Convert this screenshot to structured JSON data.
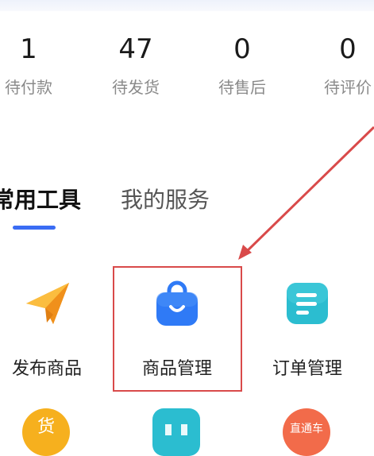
{
  "order_stats": [
    {
      "count": "1",
      "label": "待付款"
    },
    {
      "count": "47",
      "label": "待发货"
    },
    {
      "count": "0",
      "label": "待售后"
    },
    {
      "count": "0",
      "label": "待评价"
    }
  ],
  "tabs": [
    {
      "label": "常用工具",
      "active": true
    },
    {
      "label": "我的服务",
      "active": false
    }
  ],
  "tools": [
    {
      "label": "发布商品",
      "icon": "paper-plane-icon"
    },
    {
      "label": "商品管理",
      "icon": "shopping-bag-icon"
    },
    {
      "label": "订单管理",
      "icon": "document-list-icon"
    }
  ],
  "partial_row": [
    {
      "icon": "goods-badge-icon",
      "text": "货"
    },
    {
      "icon": "grid-box-icon",
      "text": ""
    },
    {
      "icon": "express-car-icon",
      "text": "直通车"
    }
  ],
  "colors": {
    "accent": "#3a6cf4",
    "annotation_red": "#d94a4a",
    "plane_orange": "#f8a623",
    "bag_blue": "#2f7af6",
    "list_teal": "#2bbdd0"
  }
}
